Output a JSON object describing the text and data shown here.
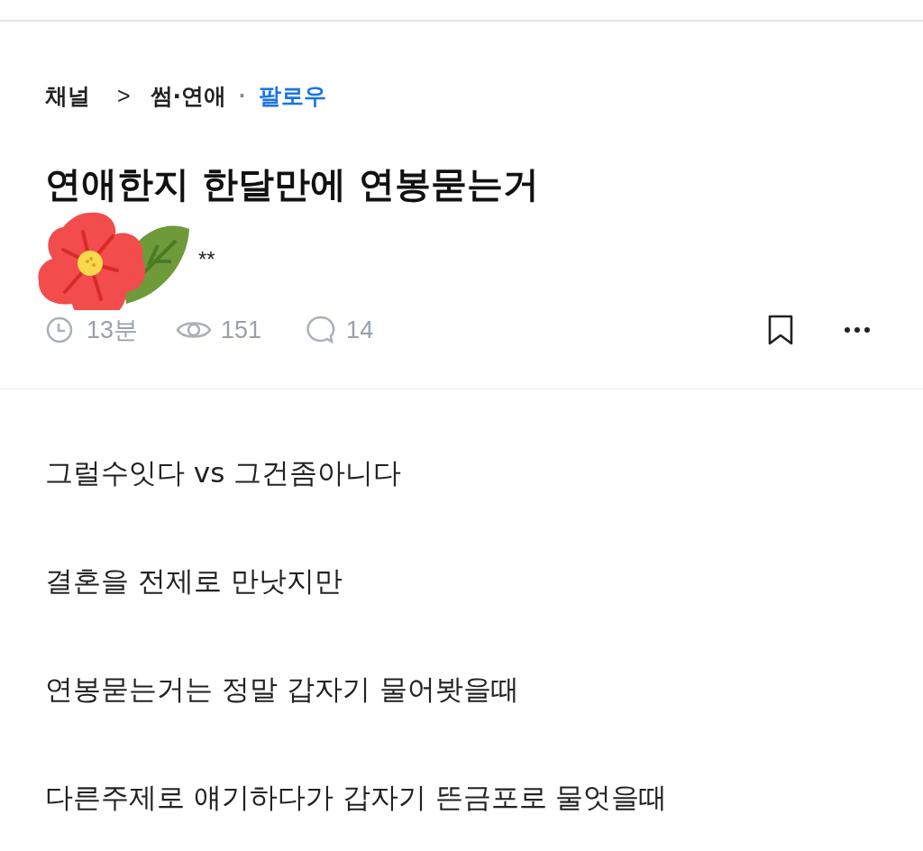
{
  "breadcrumb": {
    "channel": "채널",
    "separator": ">",
    "category": "썸·연애",
    "dot": "·",
    "follow": "팔로우"
  },
  "title": "연애한지 한달만에 연봉묻는거",
  "author": "**",
  "meta": {
    "time": "13분",
    "views": "151",
    "comments": "14"
  },
  "paragraphs": [
    "그럴수잇다 vs 그건좀아니다",
    "결혼을 전제로 만낫지만",
    "연봉묻는거는 정말 갑자기 물어봣을때",
    "다른주제로 얘기하다가 갑자기 뜬금포로 물엇을때"
  ]
}
